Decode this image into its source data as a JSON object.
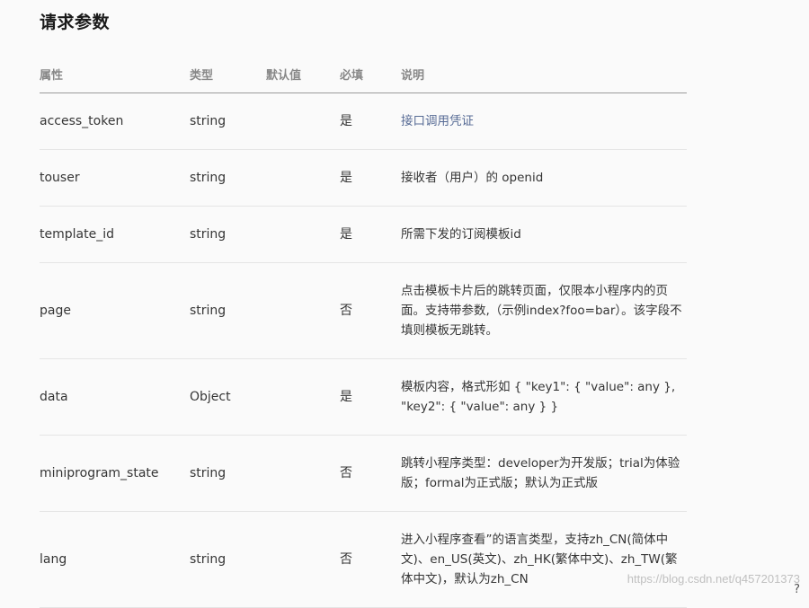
{
  "title": "请求参数",
  "columns": [
    "属性",
    "类型",
    "默认值",
    "必填",
    "说明"
  ],
  "rows": [
    {
      "attr": "access_token",
      "type": "string",
      "default": "",
      "required": "是",
      "desc": "接口调用凭证"
    },
    {
      "attr": "touser",
      "type": "string",
      "default": "",
      "required": "是",
      "desc": "接收者（用户）的 openid"
    },
    {
      "attr": "template_id",
      "type": "string",
      "default": "",
      "required": "是",
      "desc": "所需下发的订阅模板id"
    },
    {
      "attr": "page",
      "type": "string",
      "default": "",
      "required": "否",
      "desc": "点击模板卡片后的跳转页面，仅限本小程序内的页面。支持带参数,（示例index?foo=bar）。该字段不填则模板无跳转。"
    },
    {
      "attr": "data",
      "type": "Object",
      "default": "",
      "required": "是",
      "desc": "模板内容，格式形如 { \"key1\": { \"value\": any }, \"key2\": { \"value\": any } }"
    },
    {
      "attr": "miniprogram_state",
      "type": "string",
      "default": "",
      "required": "否",
      "desc": "跳转小程序类型：developer为开发版；trial为体验版；formal为正式版；默认为正式版"
    },
    {
      "attr": "lang",
      "type": "string",
      "default": "",
      "required": "否",
      "desc": "进入小程序查看”的语言类型，支持zh_CN(简体中文)、en_US(英文)、zh_HK(繁体中文)、zh_TW(繁体中文)，默认为zh_CN"
    }
  ],
  "watermark": "https://blog.csdn.net/q457201373",
  "help_glyph": "?"
}
